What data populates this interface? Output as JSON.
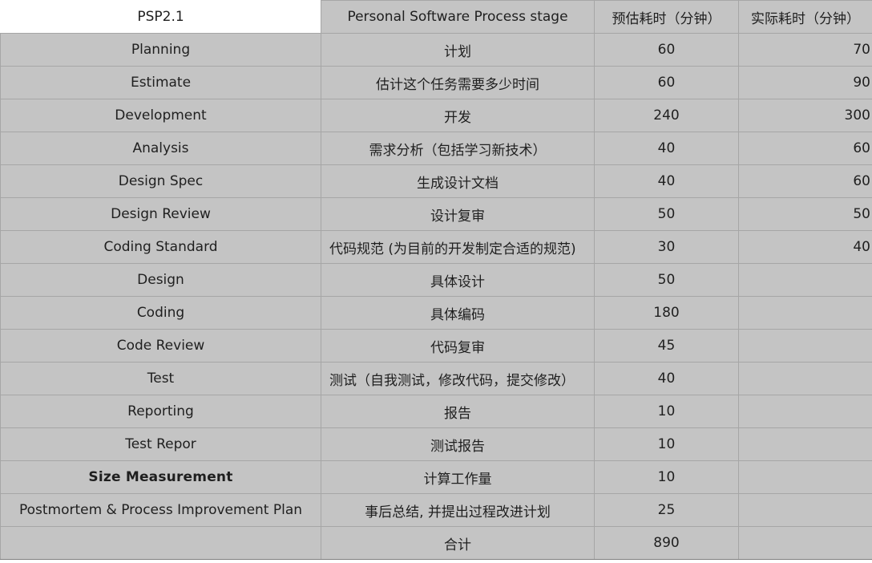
{
  "header": {
    "col0": "PSP2.1",
    "col1": "Personal  Software  Process  stage",
    "col2": "预估耗时（分钟）",
    "col3": "实际耗时（分钟）"
  },
  "rows": [
    {
      "stage": "Planning",
      "desc": "计划",
      "est": "60",
      "act": "70"
    },
    {
      "stage": "Estimate",
      "desc": "估计这个任务需要多少时间",
      "est": "60",
      "act": "90"
    },
    {
      "stage": "Development",
      "desc": "开发",
      "est": "240",
      "act": "300"
    },
    {
      "stage": "Analysis",
      "desc": "需求分析（包括学习新技术）",
      "est": "40",
      "act": "60"
    },
    {
      "stage": "Design Spec",
      "desc": "生成设计文档",
      "est": "40",
      "act": "60"
    },
    {
      "stage": "Design Review",
      "desc": "设计复审",
      "est": "50",
      "act": "50"
    },
    {
      "stage": "Coding Standard",
      "desc": "代码规范 (为目前的开发制定合适的规范)",
      "est": "30",
      "act": "40"
    },
    {
      "stage": "Design",
      "desc": "具体设计",
      "est": "50",
      "act": ""
    },
    {
      "stage": "Coding",
      "desc": "具体编码",
      "est": "180",
      "act": ""
    },
    {
      "stage": "Code Review",
      "desc": "代码复审",
      "est": "45",
      "act": ""
    },
    {
      "stage": "Test",
      "desc": "测试（自我测试，修改代码，提交修改）",
      "est": "40",
      "act": ""
    },
    {
      "stage": "Reporting",
      "desc": "报告",
      "est": "10",
      "act": ""
    },
    {
      "stage": "Test Repor",
      "desc": "测试报告",
      "est": "10",
      "act": ""
    },
    {
      "stage": "Size Measurement",
      "desc": "计算工作量",
      "est": "10",
      "act": ""
    },
    {
      "stage": "Postmortem & Process Improvement Plan",
      "desc": "事后总结, 并提出过程改进计划",
      "est": "25",
      "act": ""
    },
    {
      "stage": "",
      "desc": "合计",
      "est": "890",
      "act": ""
    }
  ]
}
